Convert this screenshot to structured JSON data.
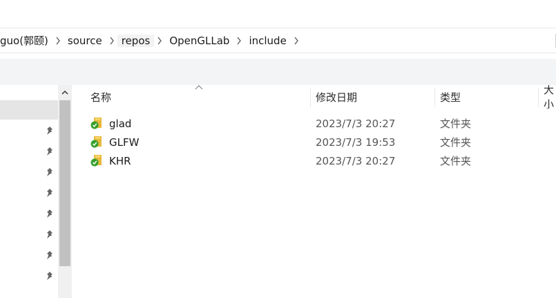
{
  "breadcrumb": {
    "segments": [
      "guo(郭颐)",
      "source",
      "repos",
      "OpenGLLab",
      "include"
    ]
  },
  "columns": {
    "name": "名称",
    "date": "修改日期",
    "type": "类型",
    "size": "大小"
  },
  "files": [
    {
      "name": "glad",
      "date": "2023/7/3 20:27",
      "type": "文件夹"
    },
    {
      "name": "GLFW",
      "date": "2023/7/3 19:53",
      "type": "文件夹"
    },
    {
      "name": "KHR",
      "date": "2023/7/3 20:27",
      "type": "文件夹"
    }
  ],
  "icons": {
    "folder": "folder-synced-icon",
    "pin": "pin-icon",
    "chevron": "chevron-right-icon",
    "sort": "sort-up-icon",
    "scroll": "scroll-up-icon"
  },
  "colors": {
    "folder": "#e8b93a",
    "sync_badge": "#36a02c",
    "selection": "#e5e5e5",
    "scroll_thumb": "#c1c1c1"
  }
}
